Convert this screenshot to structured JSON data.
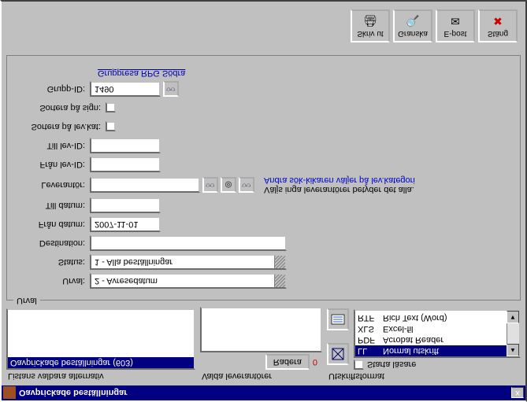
{
  "window": {
    "title": "Oavprickade beställningar",
    "close": "x"
  },
  "labels": {
    "col1": "Listans valbara alternativ",
    "col2": "Valda leverantörer",
    "col3": "Utskriftsformat",
    "radera": "Radera",
    "zero": "0",
    "starta_lasare": "Starta läsare",
    "urval_legend": "Urval",
    "urval": "Urval:",
    "status": "Status:",
    "destination": "Destination:",
    "fran_datum": "Från datum:",
    "till_datum": "Till datum:",
    "leverantor": "Leverantör:",
    "fran_lev": "Från lev-ID:",
    "till_lev": "Till lev-ID:",
    "sortera_kat": "Sortera på lev.kat:",
    "sortera_sign": "Sortera på sign:",
    "grupp_id": "Grupp-ID:",
    "grupp_link": "Gruppresa RPG Södra",
    "hint1": "Väljs inga leverantörer betyder det alla.",
    "hint2": "Andra sök-kikaren väljer på lev.kategori"
  },
  "list": {
    "item1": "Oavprickade beställningar (603)"
  },
  "formats": {
    "f1c": "LL",
    "f1n": "Normal utskrift",
    "f2c": "PDF",
    "f2n": "Acrobat Reader",
    "f3c": "XLS",
    "f3n": "Excel-fil",
    "f4c": "RTF",
    "f4n": "Rich Text (Word)"
  },
  "values": {
    "urval": "2 - Avresedatum",
    "status": "1 - Alla beställningar",
    "fran_datum": "2007-11-01",
    "grupp_id": "1490"
  },
  "toolbar": {
    "skriv": "Skriv ut",
    "granska": "Granska",
    "epost": "E-post",
    "stang": "Stäng"
  }
}
